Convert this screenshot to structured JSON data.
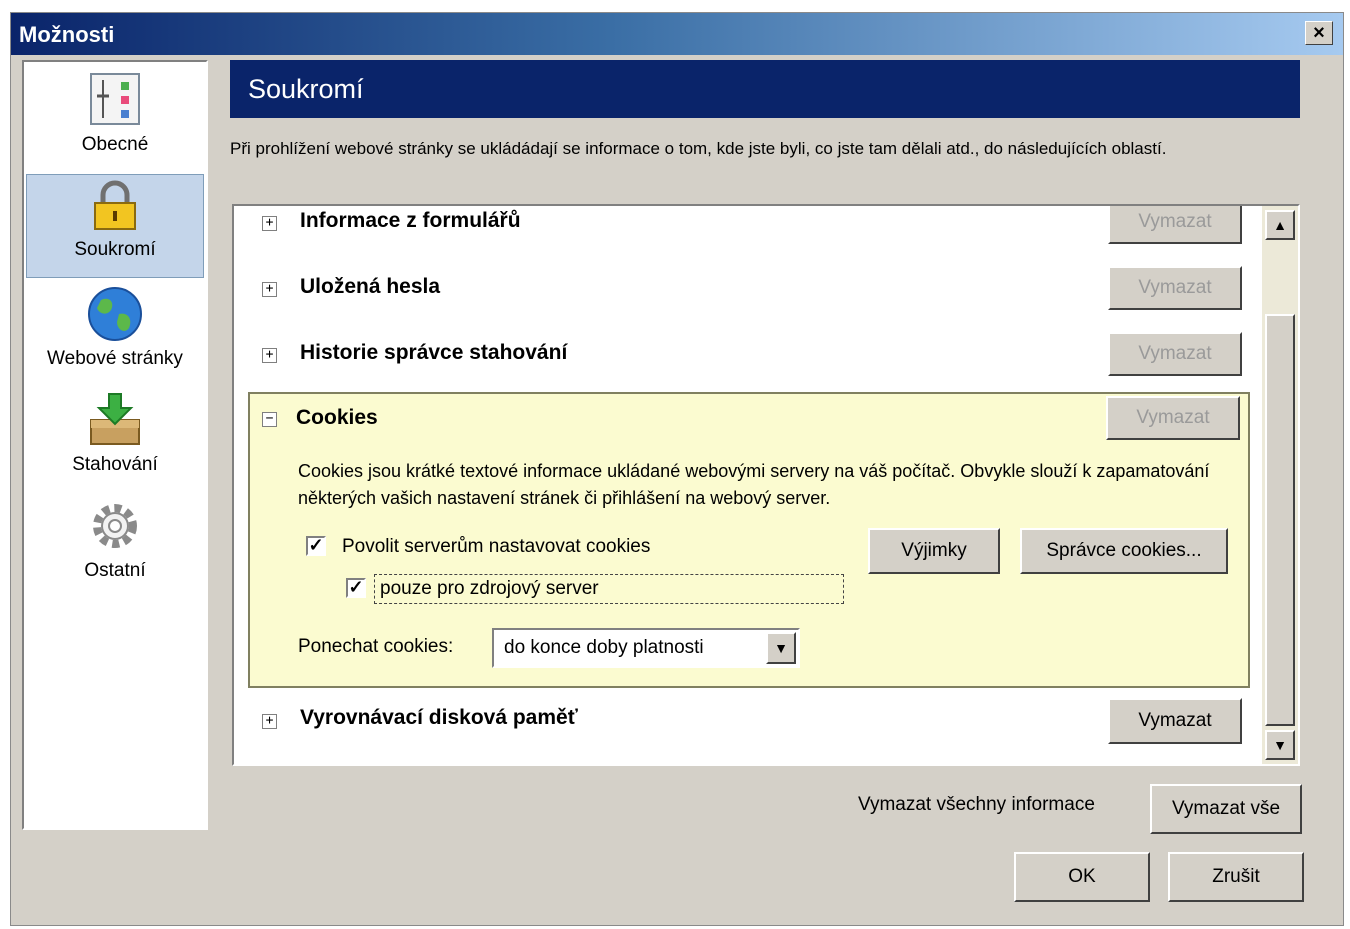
{
  "window": {
    "title": "Možnosti",
    "close_glyph": "×"
  },
  "sidebar": {
    "items": [
      {
        "label": "Obecné",
        "icon": "general-settings-icon"
      },
      {
        "label": "Soukromí",
        "icon": "lock-icon",
        "selected": true
      },
      {
        "label": "Webové stránky",
        "icon": "globe-icon"
      },
      {
        "label": "Stahování",
        "icon": "download-box-icon"
      },
      {
        "label": "Ostatní",
        "icon": "gear-icon"
      }
    ]
  },
  "panel": {
    "header": "Soukromí",
    "description": "Při prohlížení webové stránky se ukládádají se informace o tom, kde jste byli, co jste tam dělali atd., do následujících oblastí."
  },
  "sections": {
    "forms": {
      "title": "Informace z formulářů",
      "button": "Vymazat",
      "enabled": false,
      "expander": "+"
    },
    "passwords": {
      "title": "Uložená hesla",
      "button": "Vymazat",
      "enabled": false,
      "expander": "+"
    },
    "downloads": {
      "title": "Historie správce stahování",
      "button": "Vymazat",
      "enabled": false,
      "expander": "+"
    },
    "cookies": {
      "title": "Cookies",
      "button": "Vymazat",
      "enabled": false,
      "expander": "−",
      "description": "Cookies jsou krátké textové informace ukládané webovými servery na váš počítač. Obvykle slouží k zapamatování některých vašich nastavení stránek či přihlášení na webový server.",
      "allow_label": "Povolit serverům nastavovat cookies",
      "allow_checked": true,
      "origin_only_label": "pouze pro zdrojový server",
      "origin_only_checked": true,
      "exceptions_button": "Výjimky",
      "manager_button": "Správce cookies...",
      "keep_label": "Ponechat cookies:",
      "keep_value": "do konce doby platnosti"
    },
    "cache": {
      "title": "Vyrovnávací disková paměť",
      "button": "Vymazat",
      "enabled": true,
      "expander": "+"
    }
  },
  "check_glyph": "✓",
  "arrows": {
    "up": "▲",
    "down": "▼"
  },
  "footer": {
    "clear_all_label": "Vymazat všechny informace",
    "clear_all_button": "Vymazat vše",
    "ok": "OK",
    "cancel": "Zrušit"
  }
}
